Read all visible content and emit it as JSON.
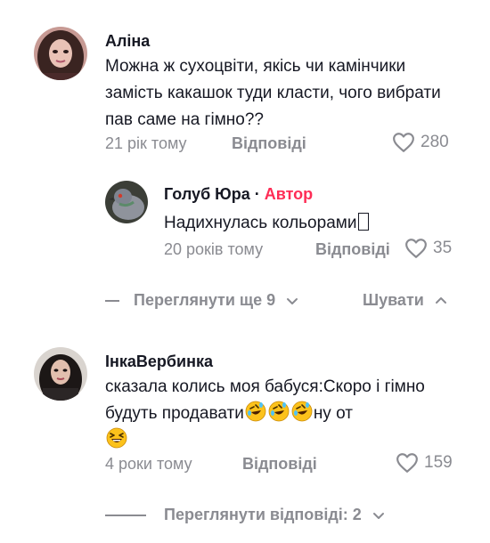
{
  "comments": [
    {
      "username": "Аліна",
      "text": "Можна ж сухоцвіти, якісь чи камінчики замість какашок туди класти, чого вибрати пав саме на гімно??",
      "time": "21 рік тому",
      "reply_label": "Відповіді",
      "likes": "280"
    },
    {
      "username": "ІнкаВербинка",
      "text_part1": "сказала колись моя бабуся:Скоро і гімно будуть продавати",
      "text_part2": "ну от",
      "time": "4 роки тому",
      "reply_label": "Відповіді",
      "likes": "159"
    }
  ],
  "reply": {
    "username": "Голуб Юра",
    "separator": "·",
    "author_tag": "Автор",
    "text": "Надихнулась кольорами",
    "time": "20 років тому",
    "reply_label": "Відповіді",
    "likes": "35"
  },
  "thread_controls": {
    "view_more": "Переглянути ще 9",
    "hide": "Шувати"
  },
  "view_replies": "Переглянути відповіді: 2",
  "icons": {
    "like": "heart-outline-icon",
    "expand": "chevron-down-icon",
    "collapse": "chevron-up-icon",
    "emoji_laugh_cry": "rolling-on-floor-laughing-emoji",
    "emoji_grin": "grinning-squinting-emoji"
  },
  "colors": {
    "text": "#161823",
    "secondary": "#8a8b91",
    "author": "#fe2c55"
  }
}
